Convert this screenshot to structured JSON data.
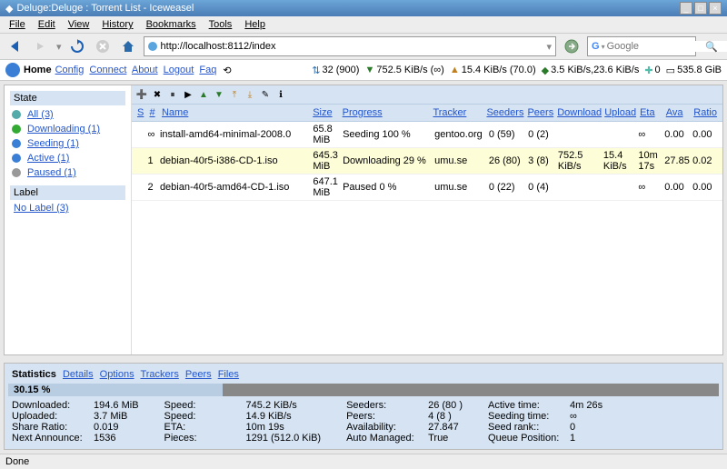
{
  "window": {
    "title": "Deluge:Deluge : Torrent List - Iceweasel"
  },
  "menu": [
    "File",
    "Edit",
    "View",
    "History",
    "Bookmarks",
    "Tools",
    "Help"
  ],
  "url": "http://localhost:8112/index",
  "search_placeholder": "Google",
  "header": {
    "home": "Home",
    "links": [
      "Config",
      "Connect",
      "About",
      "Logout",
      "Faq"
    ],
    "stats": {
      "conn": "32 (900)",
      "dl": "752.5 KiB/s (∞)",
      "ul": "15.4 KiB/s (70.0)",
      "disk": "3.5 KiB/s,23.6 KiB/s",
      "free0": "0",
      "free": "535.8 GiB"
    }
  },
  "sidebar": {
    "state_h": "State",
    "states": [
      {
        "label": "All (3)"
      },
      {
        "label": "Downloading (1)"
      },
      {
        "label": "Seeding (1)"
      },
      {
        "label": "Active (1)"
      },
      {
        "label": "Paused (1)"
      }
    ],
    "label_h": "Label",
    "labels": [
      {
        "label": "No Label (3)"
      }
    ]
  },
  "cols": {
    "s": "S",
    "n": "#",
    "name": "Name",
    "size": "Size",
    "prog": "Progress",
    "trk": "Tracker",
    "seed": "Seeders",
    "peer": "Peers",
    "dl": "Download",
    "ul": "Upload",
    "eta": "Eta",
    "ava": "Ava",
    "rat": "Ratio"
  },
  "rows": [
    {
      "n": "∞",
      "name": "install-amd64-minimal-2008.0",
      "size": "65.8 MiB",
      "prog": "Seeding 100 %",
      "trk": "gentoo.org",
      "seed": "0 (59)",
      "peer": "0 (2)",
      "dl": "",
      "ul": "",
      "eta": "∞",
      "ava": "0.00",
      "rat": "0.00"
    },
    {
      "n": "1",
      "name": "debian-40r5-i386-CD-1.iso",
      "size": "645.3 MiB",
      "prog": "Downloading 29 %",
      "trk": "umu.se",
      "seed": "26 (80)",
      "peer": "3 (8)",
      "dl": "752.5 KiB/s",
      "ul": "15.4 KiB/s",
      "eta": "10m 17s",
      "ava": "27.85",
      "rat": "0.02"
    },
    {
      "n": "2",
      "name": "debian-40r5-amd64-CD-1.iso",
      "size": "647.1 MiB",
      "prog": "Paused 0 %",
      "trk": "umu.se",
      "seed": "0 (22)",
      "peer": "0 (4)",
      "dl": "",
      "ul": "",
      "eta": "∞",
      "ava": "0.00",
      "rat": "0.00"
    }
  ],
  "tabs": {
    "stat": "Statistics",
    "det": "Details",
    "opt": "Options",
    "trk": "Trackers",
    "peer": "Peers",
    "fil": "Files"
  },
  "pct": "30.15 %",
  "pct_val": 30.15,
  "details": {
    "c1": [
      [
        "Downloaded:",
        "194.6 MiB"
      ],
      [
        "Uploaded:",
        "3.7 MiB"
      ],
      [
        "Share Ratio:",
        "0.019"
      ],
      [
        "Next Announce:",
        "1536"
      ]
    ],
    "c2": [
      [
        "Speed:",
        "745.2 KiB/s"
      ],
      [
        "Speed:",
        "14.9 KiB/s"
      ],
      [
        "ETA:",
        "10m 19s"
      ],
      [
        "Pieces:",
        "1291 (512.0 KiB)"
      ]
    ],
    "c3": [
      [
        "Seeders:",
        "26 (80 )"
      ],
      [
        "Peers:",
        "4 (8 )"
      ],
      [
        "Availability:",
        "27.847"
      ],
      [
        "Auto Managed:",
        "True"
      ]
    ],
    "c4": [
      [
        "Active time:",
        "4m 26s"
      ],
      [
        "Seeding time:",
        "∞"
      ],
      [
        "Seed rank::",
        "0"
      ],
      [
        "Queue Position:",
        "1"
      ]
    ]
  },
  "status": "Done"
}
